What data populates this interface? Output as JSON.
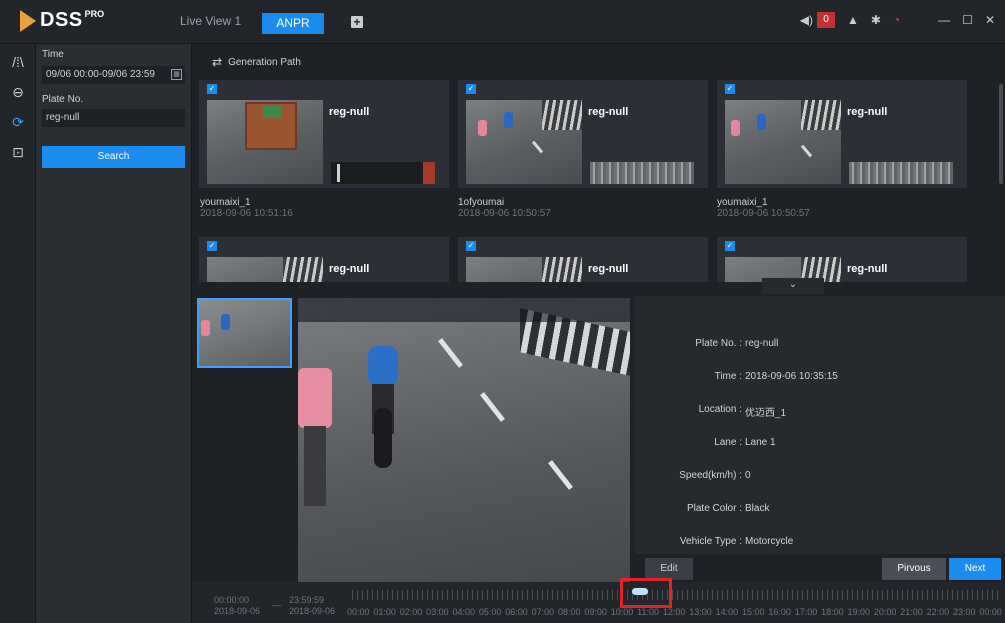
{
  "app": {
    "brand": "DSS",
    "brand_sup": "PRO"
  },
  "tabs": [
    {
      "label": "Live View 1",
      "active": false
    },
    {
      "label": "ANPR",
      "active": true
    }
  ],
  "titlebar": {
    "alarm_count": "0"
  },
  "search_panel": {
    "time_label": "Time",
    "time_value": "09/06 00:00-09/06 23:59",
    "plate_label": "Plate No.",
    "plate_value": "reg-null",
    "search_button": "Search"
  },
  "main": {
    "generation_path_label": "Generation Path"
  },
  "cards": [
    {
      "plate": "reg-null",
      "name": "youmaixi_1",
      "time": "2018-09-06 10:51:16"
    },
    {
      "plate": "reg-null",
      "name": "1ofyoumai",
      "time": "2018-09-06 10:50:57"
    },
    {
      "plate": "reg-null",
      "name": "youmaixi_1",
      "time": "2018-09-06 10:50:57"
    },
    {
      "plate": "reg-null"
    },
    {
      "plate": "reg-null"
    },
    {
      "plate": "reg-null"
    }
  ],
  "detail": {
    "fields": [
      {
        "key": "Plate No. :",
        "value": "reg-null"
      },
      {
        "key": "Time :",
        "value": "2018-09-06 10:35:15"
      },
      {
        "key": "Location :",
        "value": "优迈西_1"
      },
      {
        "key": "Lane :",
        "value": "Lane 1"
      },
      {
        "key": "Speed(km/h) :",
        "value": "0"
      },
      {
        "key": "Plate Color :",
        "value": "Black"
      },
      {
        "key": "Vehicle Type :",
        "value": "Motorcycle"
      }
    ],
    "edit_button": "Edit",
    "prev_button": "Pirvous",
    "next_button": "Next"
  },
  "timeline": {
    "start_time": "00:00:00",
    "start_date": "2018-09-06",
    "end_time": "23:59:59",
    "end_date": "2018-09-06",
    "hours": [
      "00:00",
      "01:00",
      "02:00",
      "03:00",
      "04:00",
      "05:00",
      "06:00",
      "07:00",
      "08:00",
      "09:00",
      "10:00",
      "11:00",
      "12:00",
      "13:00",
      "14:00",
      "15:00",
      "16:00",
      "17:00",
      "18:00",
      "19:00",
      "20:00",
      "21:00",
      "22:00",
      "23:00",
      "00:00"
    ]
  }
}
